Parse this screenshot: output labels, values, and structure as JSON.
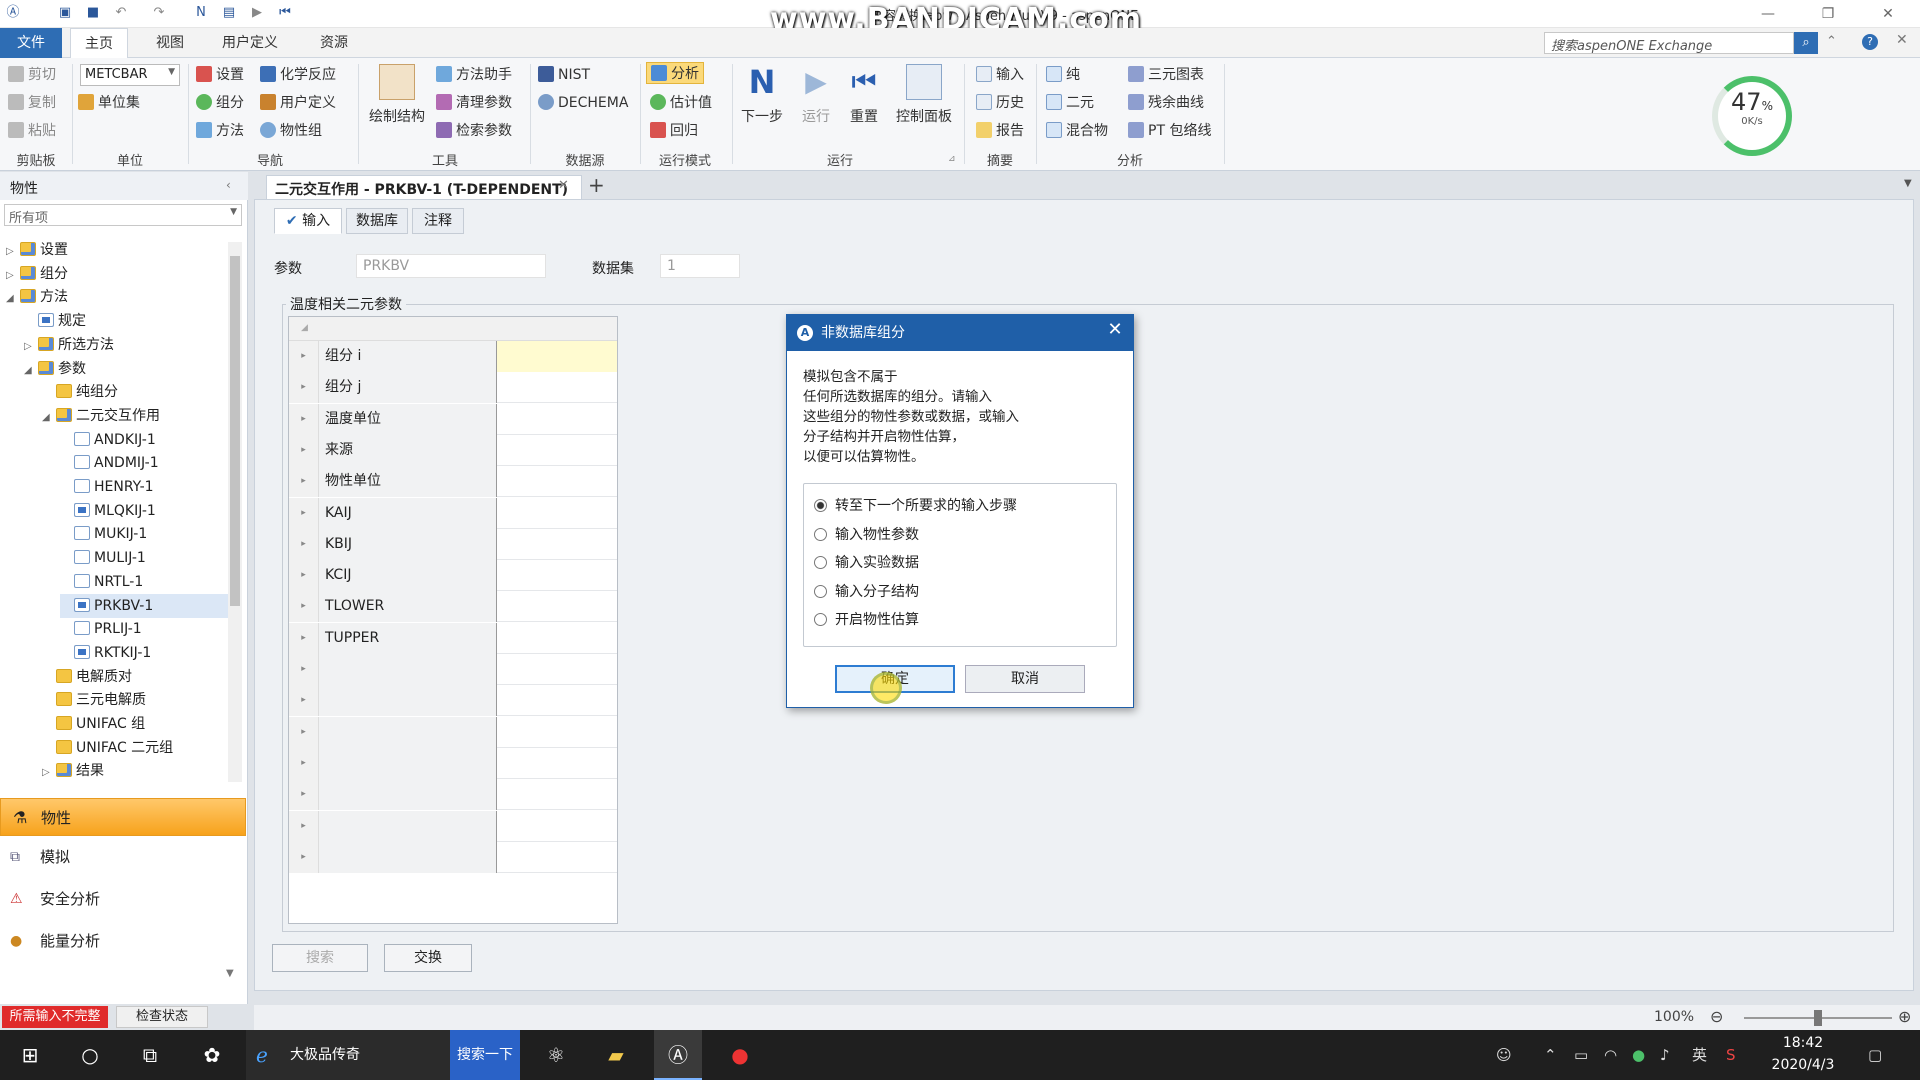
{
  "window": {
    "title": "热容转换.apw - Aspen Plus V9 - aspenONE",
    "watermark": "www.BANDICAM.com"
  },
  "menu": {
    "file": "文件",
    "home": "主页",
    "view": "视图",
    "custom": "用户定义",
    "resources": "资源",
    "search_placeholder": "搜索aspenONE Exchange"
  },
  "ribbon": {
    "clipboard": {
      "cut": "剪切",
      "copy": "复制",
      "paste": "粘贴",
      "group": "剪贴板"
    },
    "units": {
      "select": "METCBAR",
      "unitsets": "单位集",
      "group": "单位"
    },
    "nav": {
      "setup": "设置",
      "components": "组分",
      "methods": "方法",
      "chem": "化学反应",
      "custom": "用户定义",
      "propsets": "物性组",
      "group": "导航"
    },
    "tools": {
      "draw": "绘制结构",
      "helper": "方法助手",
      "clean": "清理参数",
      "retrieve": "检索参数",
      "group": "工具"
    },
    "datasource": {
      "nist": "NIST",
      "dechema": "DECHEMA",
      "group": "数据源"
    },
    "runmode": {
      "analysis": "分析",
      "estimate": "估计值",
      "regress": "回归",
      "group": "运行模式"
    },
    "run": {
      "next": "下一步",
      "run": "运行",
      "reset": "重置",
      "control": "控制面板",
      "group": "运行"
    },
    "summary": {
      "input": "输入",
      "history": "历史",
      "report": "报告",
      "group": "摘要"
    },
    "analysis": {
      "pure": "纯",
      "binary": "二元",
      "mixture": "混合物",
      "ternary": "三元图表",
      "residue": "残余曲线",
      "pt": "PT 包络线",
      "group": "分析"
    },
    "gauge": {
      "percent": "47",
      "unit": "%",
      "rate": "0K/s"
    }
  },
  "leftpane": {
    "title": "物性",
    "filter": "所有项",
    "tree": [
      {
        "label": "设置",
        "indent": 0,
        "arrow": "▷",
        "icon": "fold-b"
      },
      {
        "label": "组分",
        "indent": 0,
        "arrow": "▷",
        "icon": "fold-b"
      },
      {
        "label": "方法",
        "indent": 0,
        "arrow": "◢",
        "icon": "fold-b"
      },
      {
        "label": "规定",
        "indent": 1,
        "arrow": "",
        "icon": "chk-b"
      },
      {
        "label": "所选方法",
        "indent": 1,
        "arrow": "▷",
        "icon": "fold-b"
      },
      {
        "label": "参数",
        "indent": 1,
        "arrow": "◢",
        "icon": "fold-b"
      },
      {
        "label": "纯组分",
        "indent": 2,
        "arrow": "",
        "icon": "fold"
      },
      {
        "label": "二元交互作用",
        "indent": 2,
        "arrow": "◢",
        "icon": "fold-b"
      },
      {
        "label": "ANDKIJ-1",
        "indent": 3,
        "arrow": "",
        "icon": "chk"
      },
      {
        "label": "ANDMIJ-1",
        "indent": 3,
        "arrow": "",
        "icon": "chk"
      },
      {
        "label": "HENRY-1",
        "indent": 3,
        "arrow": "",
        "icon": "chk"
      },
      {
        "label": "MLQKIJ-1",
        "indent": 3,
        "arrow": "",
        "icon": "chk-b"
      },
      {
        "label": "MUKIJ-1",
        "indent": 3,
        "arrow": "",
        "icon": "chk"
      },
      {
        "label": "MULIJ-1",
        "indent": 3,
        "arrow": "",
        "icon": "chk"
      },
      {
        "label": "NRTL-1",
        "indent": 3,
        "arrow": "",
        "icon": "chk"
      },
      {
        "label": "PRKBV-1",
        "indent": 3,
        "arrow": "",
        "icon": "chk-b"
      },
      {
        "label": "PRLIJ-1",
        "indent": 3,
        "arrow": "",
        "icon": "chk"
      },
      {
        "label": "RKTKIJ-1",
        "indent": 3,
        "arrow": "",
        "icon": "chk-b"
      },
      {
        "label": "电解质对",
        "indent": 2,
        "arrow": "",
        "icon": "fold"
      },
      {
        "label": "三元电解质",
        "indent": 2,
        "arrow": "",
        "icon": "fold"
      },
      {
        "label": "UNIFAC 组",
        "indent": 2,
        "arrow": "",
        "icon": "fold"
      },
      {
        "label": "UNIFAC 二元组",
        "indent": 2,
        "arrow": "",
        "icon": "fold"
      },
      {
        "label": "结果",
        "indent": 2,
        "arrow": "▷",
        "icon": "fold-b"
      }
    ],
    "nav": {
      "properties": "物性",
      "simulation": "模拟",
      "safety": "安全分析",
      "energy": "能量分析"
    }
  },
  "status": {
    "error": "所需输入不完整",
    "check": "检查状态",
    "zoom": "100%"
  },
  "doc": {
    "tab_title": "二元交互作用 - PRKBV-1 (T-DEPENDENT)",
    "subtabs": {
      "input": "输入",
      "database": "数据库",
      "notes": "注释"
    },
    "param_label": "参数",
    "param_value": "PRKBV",
    "dataset_label": "数据集",
    "dataset_value": "1",
    "group_title": "温度相关二元参数",
    "rows": [
      "组分 i",
      "组分 j",
      "温度单位",
      "来源",
      "物性单位",
      "KAIJ",
      "KBIJ",
      "KCIJ",
      "TLOWER",
      "TUPPER",
      "",
      "",
      "",
      "",
      "",
      "",
      ""
    ],
    "search_btn": "搜索",
    "swap_btn": "交换"
  },
  "dialog": {
    "title": "非数据库组分",
    "message": [
      "模拟包含不属于",
      "任何所选数据库的组分。请输入",
      "这些组分的物性参数或数据，或输入",
      "分子结构并开启物性估算，",
      "以便可以估算物性。"
    ],
    "options": [
      "转至下一个所要求的输入步骤",
      "输入物性参数",
      "输入实验数据",
      "输入分子结构",
      "开启物性估算"
    ],
    "selected_option": 0,
    "ok": "确定",
    "cancel": "取消"
  },
  "taskbar": {
    "edge_label": "大极品传奇",
    "search_btn": "搜索一下",
    "ime": "英",
    "time": "18:42",
    "date": "2020/4/3"
  }
}
